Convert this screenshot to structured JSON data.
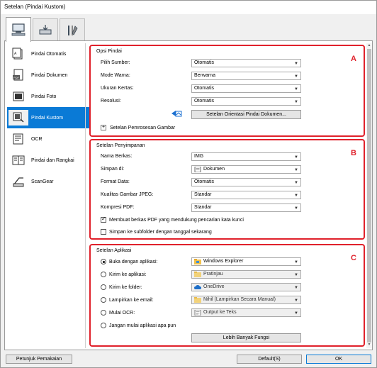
{
  "window": {
    "title": "Setelan (Pindai Kustom)"
  },
  "tabs": [
    {
      "name": "scan-from-computer",
      "icon": "computer-scan-icon"
    },
    {
      "name": "scan-from-operation-panel",
      "icon": "operation-panel-icon"
    },
    {
      "name": "general-settings",
      "icon": "tools-icon"
    }
  ],
  "sidebar": {
    "items": [
      {
        "label": "Pindai Otomatis",
        "icon": "auto-scan-icon"
      },
      {
        "label": "Pindai Dokumen",
        "icon": "document-scan-icon"
      },
      {
        "label": "Pindai Foto",
        "icon": "photo-scan-icon"
      },
      {
        "label": "Pindai Kustom",
        "icon": "custom-scan-icon",
        "selected": true
      },
      {
        "label": "OCR",
        "icon": "ocr-icon"
      },
      {
        "label": "Pindai dan Rangkai",
        "icon": "stitch-icon"
      },
      {
        "label": "ScanGear",
        "icon": "scangear-icon"
      }
    ]
  },
  "scan_options": {
    "title": "Opsi Pindai",
    "letter": "A",
    "source_label": "Pilih Sumber:",
    "source_value": "Otomatis",
    "color_mode_label": "Mode Warna:",
    "color_mode_value": "Berwarna",
    "paper_size_label": "Ukuran Kertas:",
    "paper_size_value": "Otomatis",
    "resolution_label": "Resolusi:",
    "resolution_value": "Otomatis",
    "orientation_button": "Setelan Orientasi Pindai Dokumen...",
    "image_processing_label": "Setelan Pemrosesan Gambar"
  },
  "save_settings": {
    "title": "Setelan Penyimpanan",
    "letter": "B",
    "file_name_label": "Nama Berkas:",
    "file_name_value": "IMG",
    "save_in_label": "Simpan di:",
    "save_in_value": "Dokumen",
    "data_format_label": "Format Data:",
    "data_format_value": "Otomatis",
    "jpeg_quality_label": "Kualitas Gambar JPEG:",
    "jpeg_quality_value": "Standar",
    "pdf_compression_label": "Kompresi PDF:",
    "pdf_compression_value": "Standar",
    "searchable_pdf_label": "Membuat berkas PDF yang mendukung pencarian kata kunci",
    "searchable_pdf_checked": true,
    "subfolder_label": "Simpan ke subfolder dengan tanggal sekarang",
    "subfolder_checked": false
  },
  "app_settings": {
    "title": "Setelan Aplikasi",
    "letter": "C",
    "open_with_label": "Buka dengan aplikasi:",
    "open_with_value": "Windows Explorer",
    "send_to_app_label": "Kirim ke aplikasi:",
    "send_to_app_value": "Pratinjau",
    "send_to_folder_label": "Kirim ke folder:",
    "send_to_folder_value": "OneDrive",
    "attach_email_label": "Lampirkan ke email:",
    "attach_email_value": "Nihil (Lampirkan Secara Manual)",
    "start_ocr_label": "Mulai OCR:",
    "start_ocr_value": "Output ke Teks",
    "no_app_label": "Jangan mulai aplikasi apa pun",
    "more_functions_button": "Lebih Banyak Fungsi"
  },
  "footer": {
    "instructions_button": "Petunjuk Pemakaian",
    "defaults_button": "Default(S)",
    "ok_button": "OK"
  }
}
